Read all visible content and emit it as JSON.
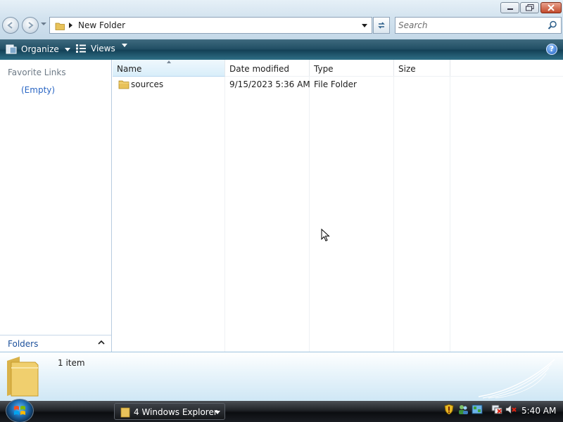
{
  "window": {
    "controls": {
      "minimize": "minimize",
      "maximize": "restore",
      "close": "close"
    }
  },
  "address": {
    "crumb": "New Folder"
  },
  "search": {
    "placeholder": "Search"
  },
  "toolbar": {
    "organize_label": "Organize",
    "views_label": "Views"
  },
  "navpane": {
    "favorites_title": "Favorite Links",
    "favorites_empty": "(Empty)",
    "folders_label": "Folders"
  },
  "filelist": {
    "columns": [
      "Name",
      "Date modified",
      "Type",
      "Size"
    ],
    "rows": [
      {
        "name": "sources",
        "date_modified": "9/15/2023 5:36 AM",
        "type": "File Folder",
        "size": ""
      }
    ]
  },
  "details": {
    "item_count": "1 item"
  },
  "taskbar": {
    "task_label": "4 Windows Explorer",
    "clock": "5:40 AM"
  },
  "colors": {
    "toolbar": "#1f4d63",
    "link": "#2a66c4",
    "folder_yellow": "#e8c25a",
    "header_highlight": "#d9eefa"
  }
}
